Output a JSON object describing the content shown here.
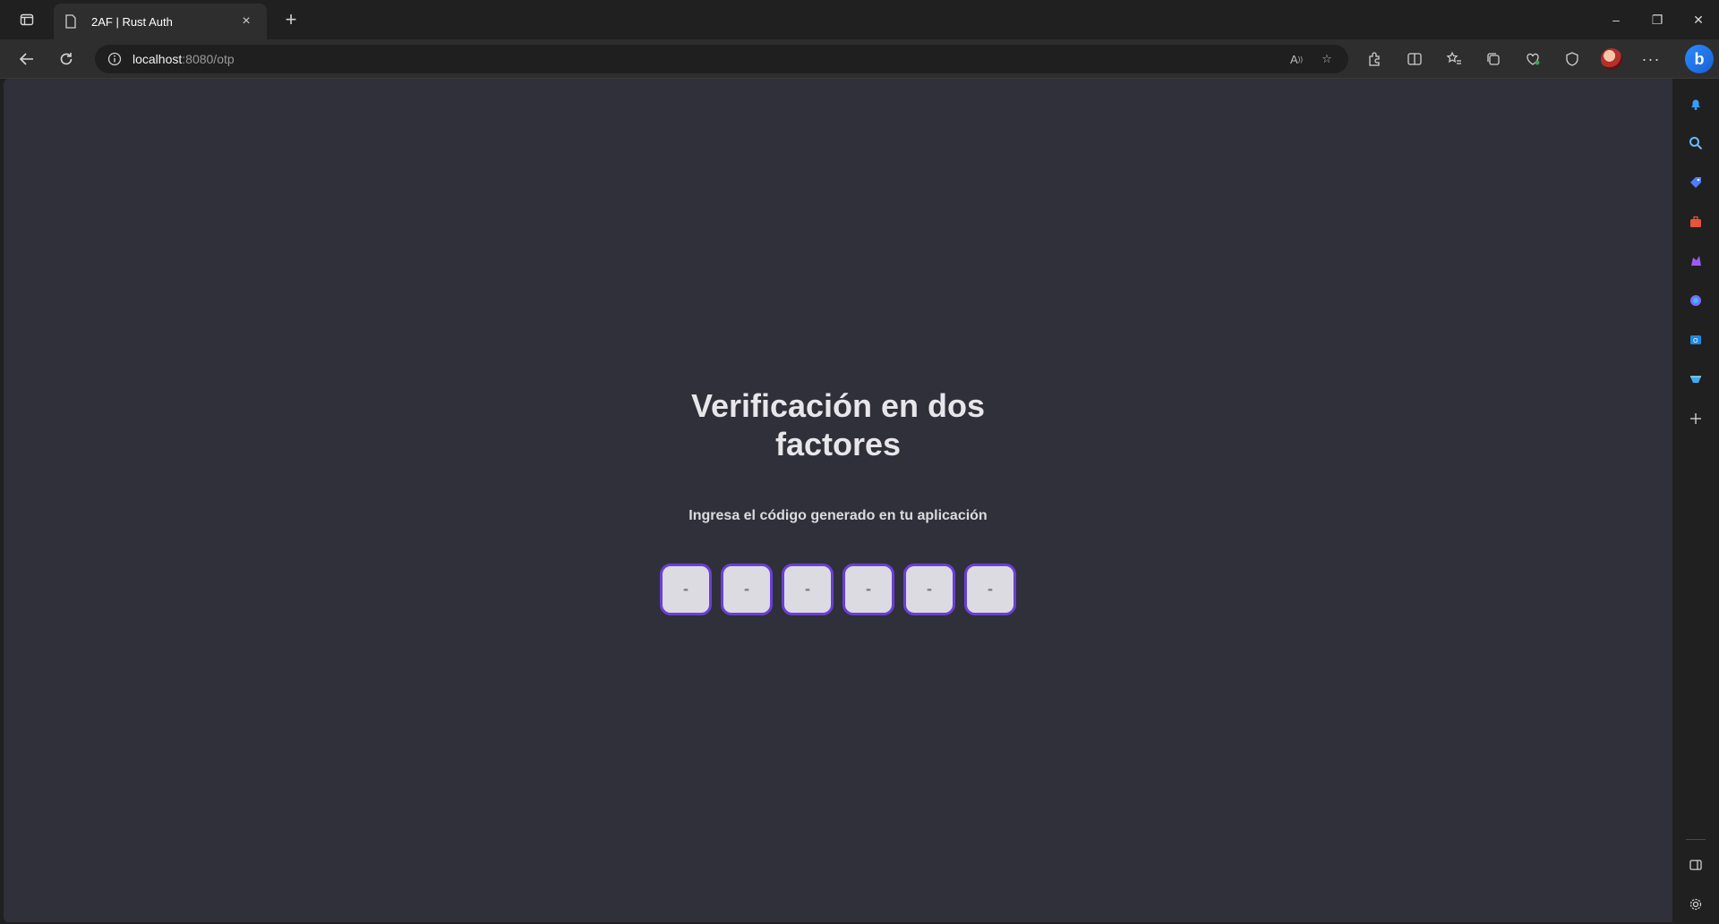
{
  "browser": {
    "tab": {
      "title": "2AF | Rust Auth",
      "close_icon": "×"
    },
    "new_tab_icon": "+",
    "address": {
      "host": "localhost",
      "rest": ":8080/otp"
    },
    "window_controls": {
      "minimize": "–",
      "restore": "❐",
      "close": "✕"
    },
    "bing_label": "b"
  },
  "page": {
    "title": "Verificación en dos factores",
    "subtitle": "Ingresa el código generado en tu aplicación",
    "otp": {
      "digit_count": 6,
      "placeholders": [
        "-",
        "-",
        "-",
        "-",
        "-",
        "-"
      ],
      "border_color": "#6a3fd6",
      "fill_color": "#dcdbe2"
    }
  },
  "sidebar": {
    "items": [
      "bell-icon",
      "search-icon",
      "shopping-tag-icon",
      "tools-icon",
      "games-icon",
      "copilot-icon",
      "outlook-icon",
      "drop-icon",
      "add-icon"
    ],
    "bottom": [
      "sidebar-toggle-icon",
      "settings-icon"
    ]
  },
  "theme": {
    "page_background": "#2f3039",
    "chrome_background": "#202020",
    "toolbar_background": "#2e2e2e"
  }
}
